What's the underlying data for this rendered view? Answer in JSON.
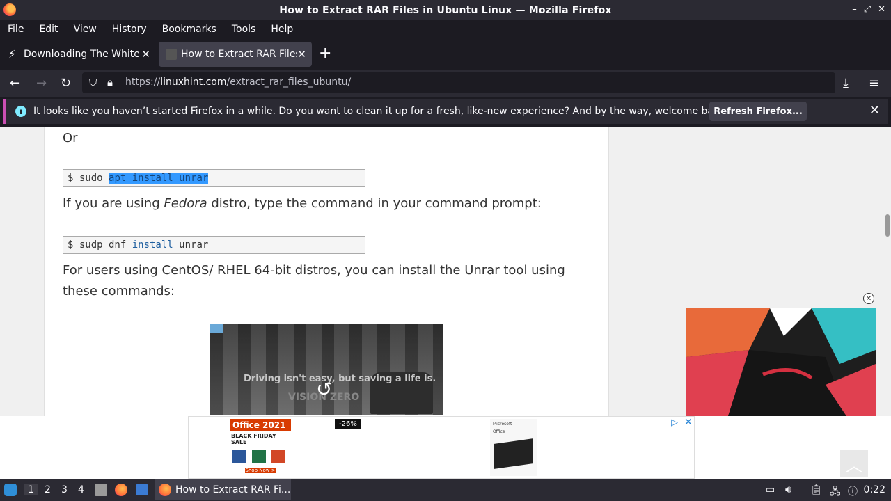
{
  "window": {
    "title": "How to Extract RAR Files in Ubuntu Linux — Mozilla Firefox"
  },
  "menu": [
    "File",
    "Edit",
    "View",
    "History",
    "Bookmarks",
    "Tools",
    "Help"
  ],
  "tabs": [
    {
      "label": "Downloading The White H",
      "active": false
    },
    {
      "label": "How to Extract RAR Files",
      "active": true
    }
  ],
  "url": {
    "prefix": "https://",
    "domain": "linuxhint.com",
    "path": "/extract_rar_files_ubuntu/"
  },
  "notification": {
    "text": "It looks like you haven’t started Firefox in a while. Do you want to clean it up for a fresh, like-new experience? And by the way, welcome back!",
    "button": "Refresh Firefox..."
  },
  "article": {
    "or": "Or",
    "code1": {
      "prompt": "$ sudo ",
      "selected": "apt install unrar"
    },
    "para1_a": "If you are using ",
    "para1_em": "Fedora",
    "para1_b": " distro, type the command in your command prompt:",
    "code2": {
      "prompt": "$ sudp dnf ",
      "kw": "install",
      "rest": " unrar"
    },
    "para2_line1": "For users using CentOS/ RHEL 64-bit distros, you can install the Unrar tool using",
    "para2_line2": "these commands:"
  },
  "video": {
    "caption": "Driving isn't easy, but saving a life is.",
    "brand": "VISION ZERO"
  },
  "ads": {
    "office_title": "Office 2021",
    "office_sale": "BLACK FRIDAY SALE",
    "office_cta": "Shop Now >",
    "discount": "-26%",
    "ms_label": "Microsoft",
    "ms_product": "Office"
  },
  "taskbar": {
    "workspaces": [
      "1",
      "2",
      "3",
      "4"
    ],
    "task_label": "How to Extract RAR Fi...",
    "clock": "0:22"
  },
  "colors": {
    "accent": "#cb4fb3",
    "selection": "#3399ff",
    "chrome": "#2b2a33"
  }
}
